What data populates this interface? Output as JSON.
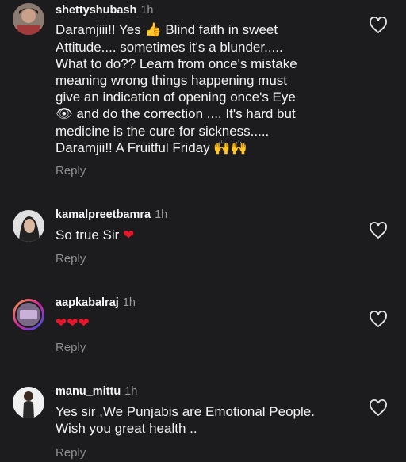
{
  "comments": [
    {
      "username": "shettyshubash",
      "time": "1h",
      "text_line1_a": "Daramjiii!! Yes ",
      "text_emoji1": "👍",
      "text_line1_b": " Blind faith in sweet",
      "text_mid": "Attitude.... sometimes it's a blunder.....\nWhat to do?? Learn from once's mistake\nmeaning wrong things happening must\ngive an indication of  opening once's Eye",
      "text_emoji2": "👁",
      "text_line6_b": "  and do the correction .... It's hard but",
      "text_line7": "medicine is the cure for sickness.....",
      "text_line8_a": "Daramjii!! A Fruitful Friday ",
      "text_emoji3": "🙌🙌",
      "reply_label": "Reply",
      "avatar_icon": "user-avatar-icon"
    },
    {
      "username": "kamalpreetbamra",
      "time": "1h",
      "text": "So true Sir ",
      "emoji": "❤",
      "reply_label": "Reply",
      "avatar_icon": "user-avatar-icon"
    },
    {
      "username": "aapkabalraj",
      "time": "1h",
      "emoji": "❤❤❤",
      "reply_label": "Reply",
      "avatar_icon": "user-avatar-icon"
    },
    {
      "username": "manu_mittu",
      "time": "1h",
      "text": "Yes sir ,We Punjabis are Emotional People.\nWish you great health ..",
      "reply_label": "Reply",
      "avatar_icon": "user-avatar-icon"
    }
  ],
  "colors": {
    "background": "#1c1c1e",
    "heart": "#e8162b",
    "muted": "#8e8e8e"
  }
}
